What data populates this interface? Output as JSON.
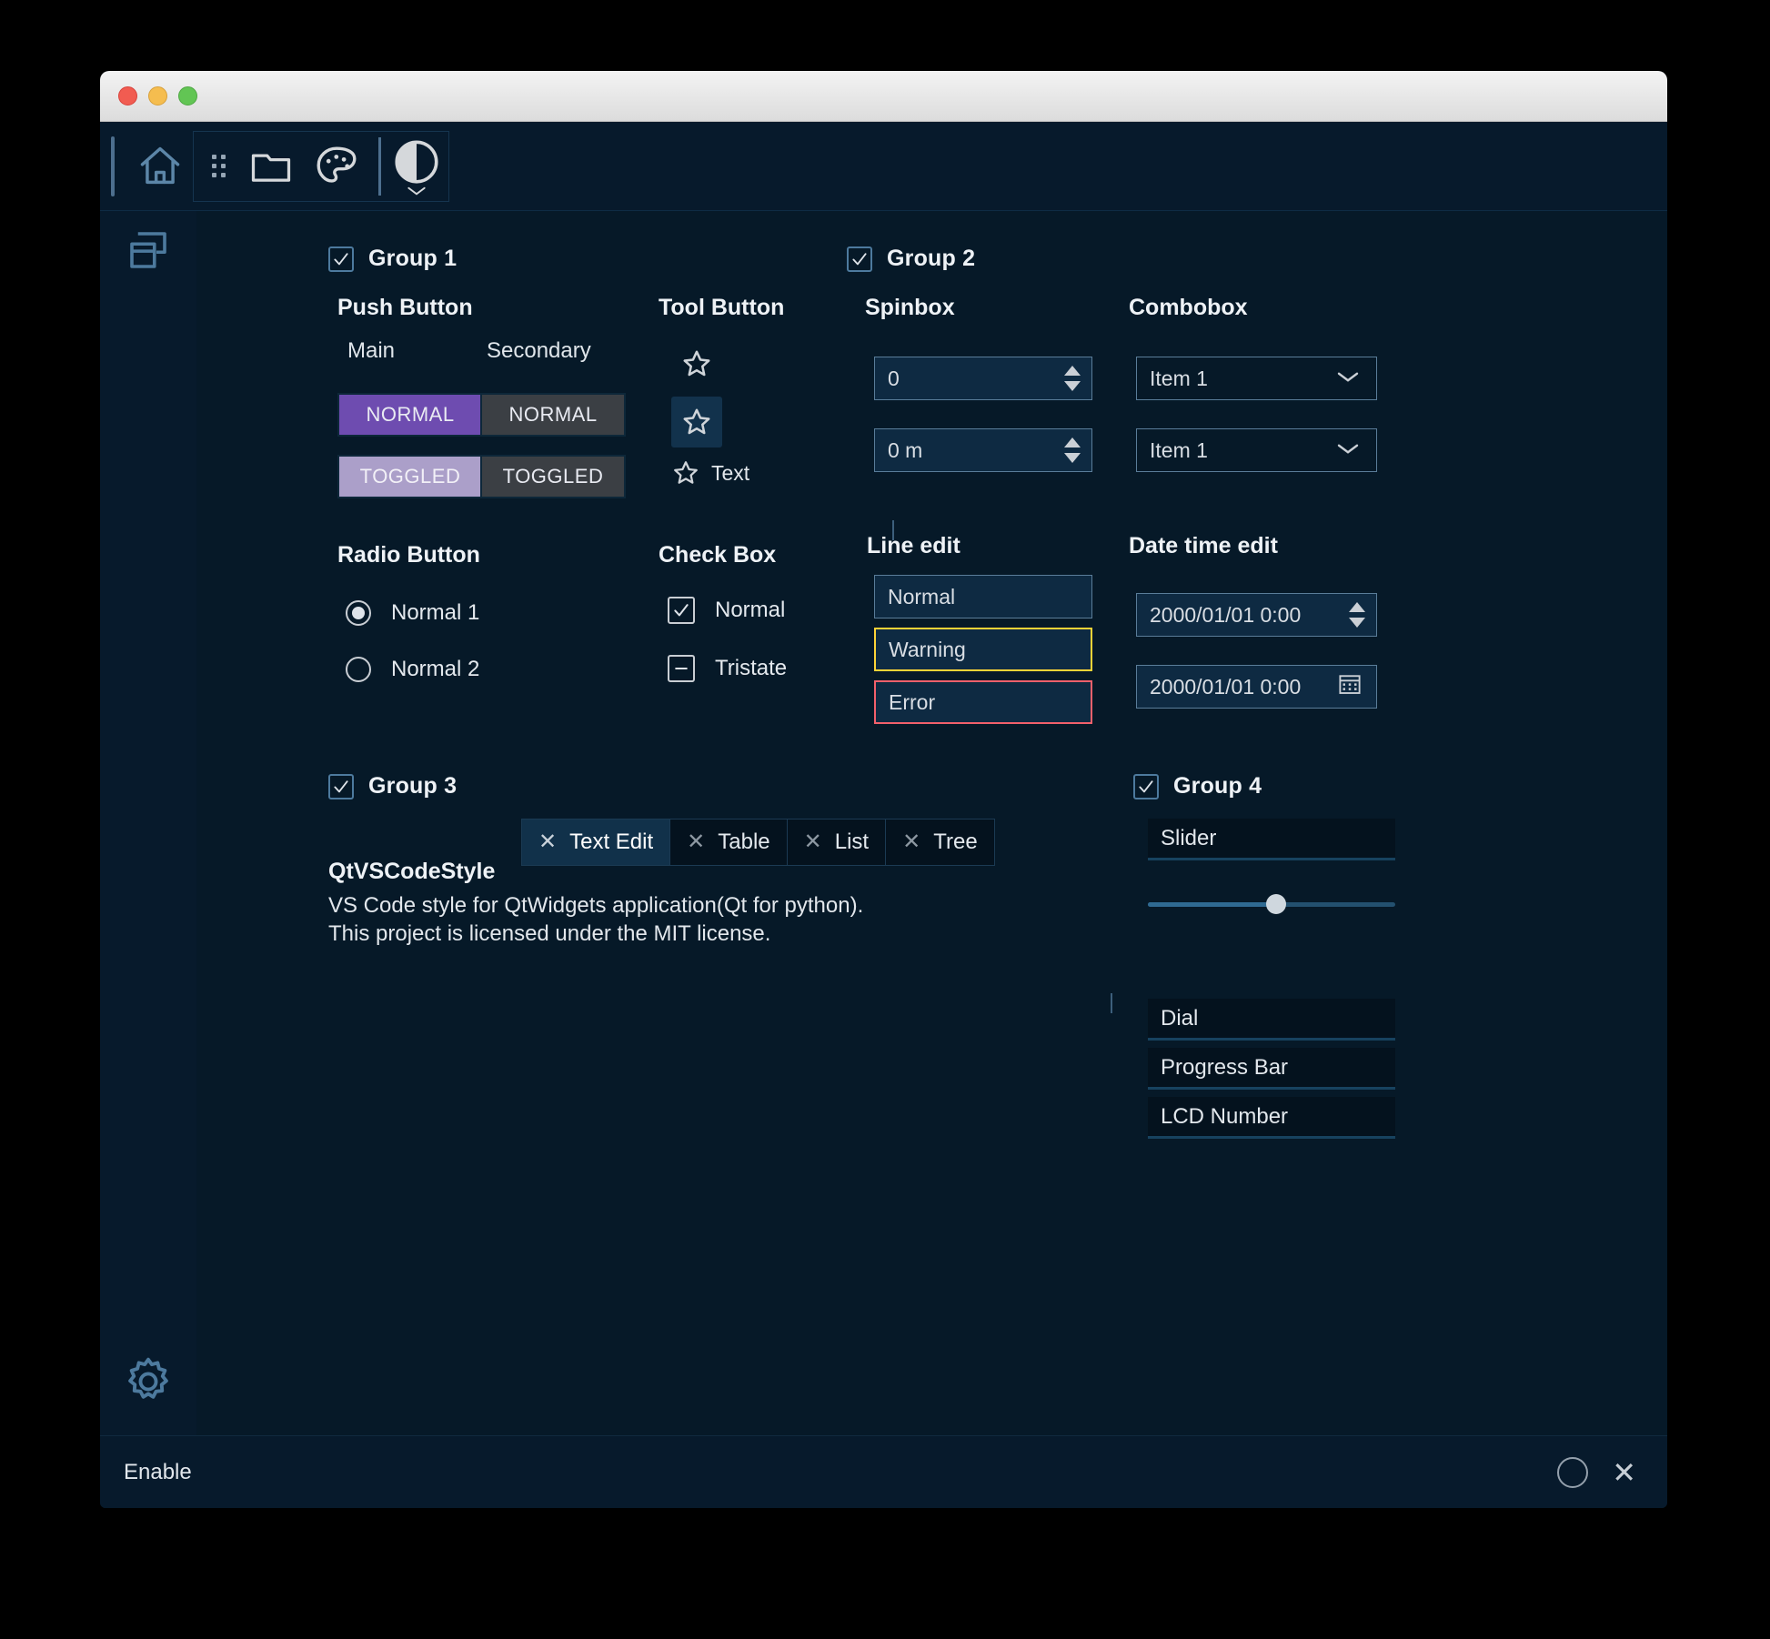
{
  "window": {
    "title": "",
    "traffic_lights": [
      "close",
      "minimize",
      "maximize"
    ]
  },
  "toolbar": {
    "items": [
      {
        "name": "home",
        "icon": "home-icon"
      },
      {
        "name": "drag-handle",
        "icon": "grip-dots-icon"
      },
      {
        "name": "folder",
        "icon": "folder-icon"
      },
      {
        "name": "palette",
        "icon": "palette-icon"
      },
      {
        "name": "theme-contrast",
        "icon": "contrast-circle-icon"
      }
    ]
  },
  "rail": {
    "items": [
      {
        "name": "panels",
        "icon": "window-panels-icon"
      }
    ],
    "bottom": {
      "name": "settings",
      "icon": "gear-icon"
    }
  },
  "group1": {
    "title": "Group 1",
    "checked": true,
    "push_button": {
      "title": "Push Button",
      "columns": [
        "Main",
        "Secondary"
      ],
      "main": {
        "normal": "NORMAL",
        "toggled": "TOGGLED"
      },
      "secondary": {
        "normal": "NORMAL",
        "toggled": "TOGGLED"
      }
    },
    "tool_button": {
      "title": "Tool Button",
      "items": [
        {
          "label": "",
          "icon": "star-icon",
          "selected": false
        },
        {
          "label": "",
          "icon": "star-icon",
          "selected": true
        },
        {
          "label": "Text",
          "icon": "star-icon",
          "selected": false
        }
      ]
    },
    "radio_button": {
      "title": "Radio Button",
      "options": [
        {
          "label": "Normal 1",
          "checked": true
        },
        {
          "label": "Normal 2",
          "checked": false
        }
      ]
    },
    "check_box": {
      "title": "Check Box",
      "options": [
        {
          "label": "Normal",
          "state": "checked"
        },
        {
          "label": "Tristate",
          "state": "partial"
        }
      ]
    }
  },
  "group2": {
    "title": "Group 2",
    "checked": true,
    "spinbox": {
      "title": "Spinbox",
      "values": [
        "0",
        "0 m"
      ]
    },
    "combobox": {
      "title": "Combobox",
      "values": [
        "Item 1",
        "Item 1"
      ],
      "options": [
        "Item 1"
      ]
    },
    "line_edit": {
      "title": "Line edit",
      "fields": [
        {
          "value": "Normal",
          "state": "normal"
        },
        {
          "value": "Warning",
          "state": "warning"
        },
        {
          "value": "Error",
          "state": "error"
        }
      ]
    },
    "date_time_edit": {
      "title": "Date time edit",
      "values": [
        "2000/01/01 0:00",
        "2000/01/01 0:00"
      ]
    }
  },
  "group3": {
    "title": "Group 3",
    "checked": true,
    "tabs": [
      {
        "label": "Text Edit",
        "active": true
      },
      {
        "label": "Table",
        "active": false
      },
      {
        "label": "List",
        "active": false
      },
      {
        "label": "Tree",
        "active": false
      }
    ],
    "text_edit": {
      "heading": "QtVSCodeStyle",
      "lines": [
        "VS Code style for QtWidgets application(Qt for python).",
        "This project is licensed under the MIT license."
      ]
    }
  },
  "group4": {
    "title": "Group 4",
    "checked": true,
    "slider": {
      "label": "Slider",
      "value": 52
    },
    "items": [
      {
        "label": "Dial"
      },
      {
        "label": "Progress Bar"
      },
      {
        "label": "LCD Number"
      }
    ]
  },
  "statusbar": {
    "text": "Enable",
    "buttons": [
      {
        "name": "spinner",
        "icon": "circle-icon"
      },
      {
        "name": "close",
        "icon": "close-icon"
      }
    ]
  },
  "colors": {
    "window_bg": "#061928",
    "chrome_bg": "#071a2c",
    "accent_purple": "#6e4cb0",
    "accent_purple_toggled": "#ab9fc9",
    "secondary_gray": "#3b3f44",
    "warning": "#fdd337",
    "error": "#f2606b",
    "border": "#5a7d99",
    "field_bg": "#0e2a42",
    "text": "#dfe5ea"
  }
}
